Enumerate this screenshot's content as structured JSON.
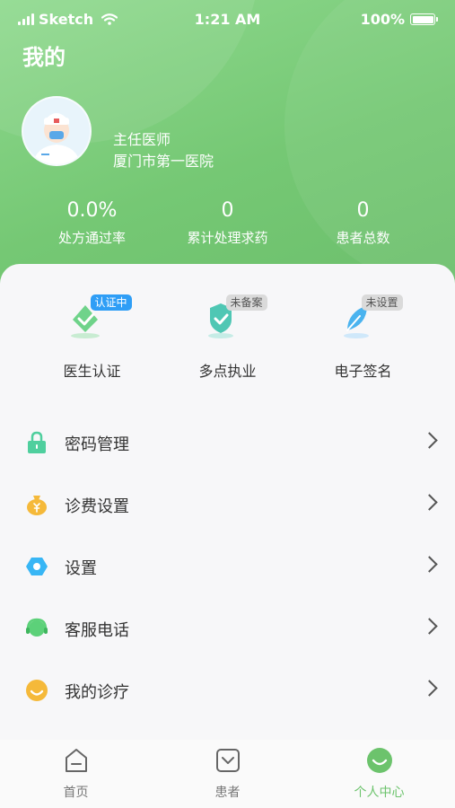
{
  "status_bar": {
    "carrier": "Sketch",
    "time": "1:21 AM",
    "battery": "100%"
  },
  "page_title": "我的",
  "profile": {
    "title": "主任医师",
    "hospital": "厦门市第一医院"
  },
  "stats": [
    {
      "value": "0.0%",
      "label": "处方通过率"
    },
    {
      "value": "0",
      "label": "累计处理求药"
    },
    {
      "value": "0",
      "label": "患者总数"
    }
  ],
  "certs": [
    {
      "label": "医生认证",
      "tag": "认证中",
      "icon": "check-shield-icon"
    },
    {
      "label": "多点执业",
      "tag": "未备案",
      "icon": "shield-check-icon"
    },
    {
      "label": "电子签名",
      "tag": "未设置",
      "icon": "feather-icon"
    }
  ],
  "menu": [
    {
      "label": "密码管理",
      "icon": "lock-icon"
    },
    {
      "label": "诊费设置",
      "icon": "money-bag-icon"
    },
    {
      "label": "设置",
      "icon": "gear-icon"
    },
    {
      "label": "客服电话",
      "icon": "headset-icon"
    },
    {
      "label": "我的诊疗",
      "icon": "smile-icon"
    }
  ],
  "tabs": [
    {
      "label": "首页",
      "icon": "home-icon"
    },
    {
      "label": "患者",
      "icon": "patient-icon"
    },
    {
      "label": "个人中心",
      "icon": "profile-icon",
      "active": true
    }
  ],
  "colors": {
    "brand": "#75c874",
    "tag_blue": "#2f9ef6",
    "active_tab": "#6cc36c"
  }
}
